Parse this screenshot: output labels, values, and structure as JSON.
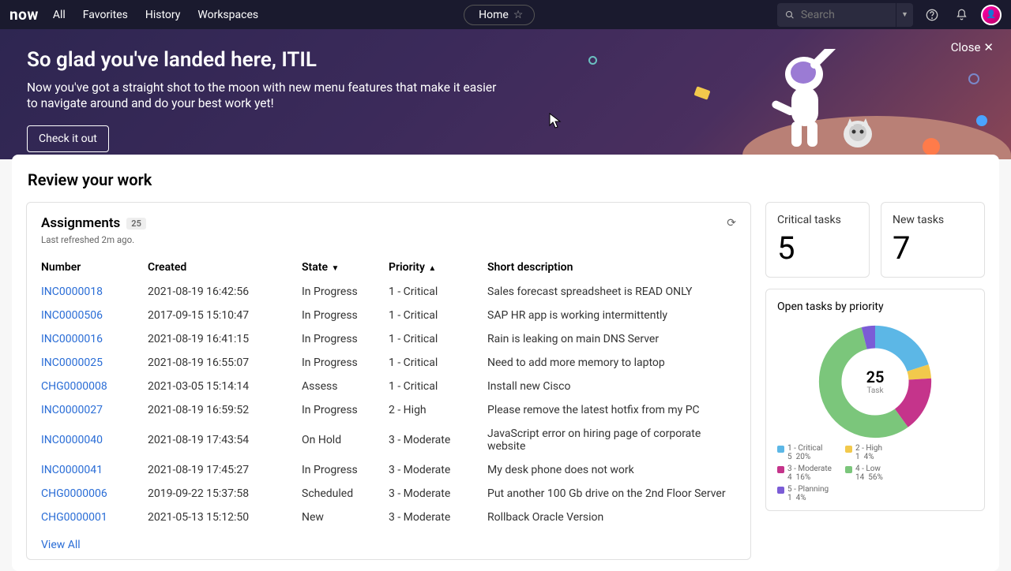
{
  "nav": {
    "logo": "now",
    "links": [
      "All",
      "Favorites",
      "History",
      "Workspaces"
    ],
    "home": "Home",
    "search_placeholder": "Search",
    "close": "Close"
  },
  "banner": {
    "title": "So glad you've landed here, ITIL",
    "body": "Now you've got a straight shot to the moon with new menu features that make it easier to navigate around and do your best work yet!",
    "cta": "Check it out"
  },
  "card": {
    "title": "Review your work",
    "assignments": {
      "title": "Assignments",
      "badge": "25",
      "subtitle": "Last refreshed 2m ago.",
      "cols": {
        "number": "Number",
        "created": "Created",
        "state": "State",
        "priority": "Priority",
        "desc": "Short description"
      },
      "rows": [
        {
          "num": "INC0000018",
          "created": "2021-08-19 16:42:56",
          "state": "In Progress",
          "priority": "1 - Critical",
          "desc": "Sales forecast spreadsheet is READ ONLY"
        },
        {
          "num": "INC0000506",
          "created": "2017-09-15 15:10:47",
          "state": "In Progress",
          "priority": "1 - Critical",
          "desc": "SAP HR app is working intermittently"
        },
        {
          "num": "INC0000016",
          "created": "2021-08-19 16:41:15",
          "state": "In Progress",
          "priority": "1 - Critical",
          "desc": "Rain is leaking on main DNS Server"
        },
        {
          "num": "INC0000025",
          "created": "2021-08-19 16:55:07",
          "state": "In Progress",
          "priority": "1 - Critical",
          "desc": "Need to add more memory to laptop"
        },
        {
          "num": "CHG0000008",
          "created": "2021-03-05 15:14:14",
          "state": "Assess",
          "priority": "1 - Critical",
          "desc": "Install new Cisco"
        },
        {
          "num": "INC0000027",
          "created": "2021-08-19 16:59:52",
          "state": "In Progress",
          "priority": "2 - High",
          "desc": "Please remove the latest hotfix from my PC"
        },
        {
          "num": "INC0000040",
          "created": "2021-08-19 17:43:54",
          "state": "On Hold",
          "priority": "3 - Moderate",
          "desc": "JavaScript error on hiring page of corporate website"
        },
        {
          "num": "INC0000041",
          "created": "2021-08-19 17:45:27",
          "state": "In Progress",
          "priority": "3 - Moderate",
          "desc": "My desk phone does not work"
        },
        {
          "num": "CHG0000006",
          "created": "2019-09-22 15:37:58",
          "state": "Scheduled",
          "priority": "3 - Moderate",
          "desc": "Put another 100 Gb drive on the 2nd Floor Server"
        },
        {
          "num": "CHG0000001",
          "created": "2021-05-13 15:12:50",
          "state": "New",
          "priority": "3 - Moderate",
          "desc": "Rollback Oracle Version"
        }
      ],
      "viewall": "View All"
    },
    "stats": {
      "critical": {
        "label": "Critical tasks",
        "value": "5"
      },
      "new": {
        "label": "New tasks",
        "value": "7"
      }
    },
    "chart": {
      "title": "Open tasks by priority",
      "center_num": "25",
      "center_label": "Task"
    }
  },
  "chart_data": {
    "type": "pie",
    "title": "Open tasks by priority",
    "series": [
      {
        "name": "1 - Critical",
        "value": 5,
        "pct": 20,
        "color": "#5cb7e6"
      },
      {
        "name": "2 - High",
        "value": 1,
        "pct": 4,
        "color": "#f2c94c"
      },
      {
        "name": "3 - Moderate",
        "value": 4,
        "pct": 16,
        "color": "#c5348b"
      },
      {
        "name": "4 - Low",
        "value": 14,
        "pct": 56,
        "color": "#7bc67b"
      },
      {
        "name": "5 - Planning",
        "value": 1,
        "pct": 4,
        "color": "#7b5cd6"
      }
    ],
    "total": 25
  }
}
